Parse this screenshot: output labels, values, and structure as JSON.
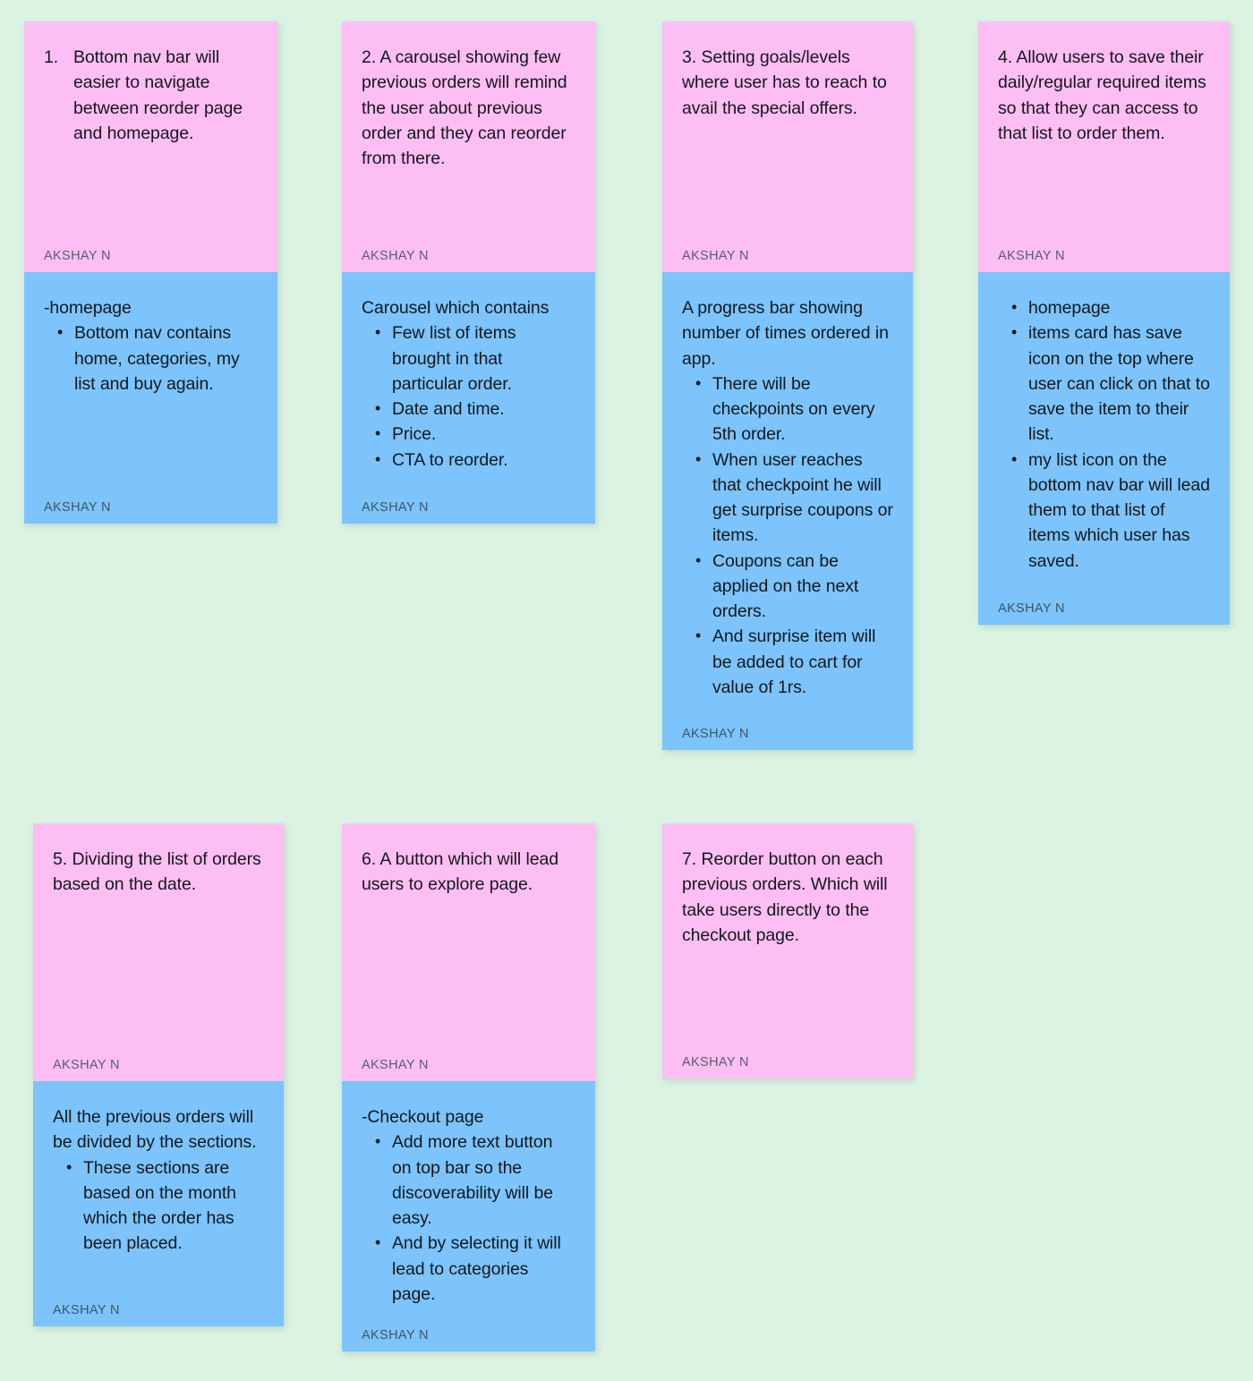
{
  "board": {
    "background_color": "#dbf3e3",
    "pink_color": "#fdbef4",
    "blue_color": "#7cc4fb",
    "author": "AKSHAY N"
  },
  "cards": [
    {
      "id": "1",
      "pink": {
        "number": "1.",
        "heading": "Bottom nav bar will easier to navigate between reorder page and homepage.",
        "author": "AKSHAY N"
      },
      "blue": {
        "lead": "-homepage",
        "bullets": [
          "Bottom nav contains home, categories, my list and buy again."
        ],
        "author": "AKSHAY N"
      }
    },
    {
      "id": "2",
      "pink": {
        "heading": "2. A carousel showing few previous orders will remind the user about previous order and they can reorder from there.",
        "author": "AKSHAY N"
      },
      "blue": {
        "lead": "Carousel which contains",
        "bullets": [
          "Few list of items brought in that particular order.",
          "Date and time.",
          "Price.",
          "CTA to reorder."
        ],
        "author": "AKSHAY N"
      }
    },
    {
      "id": "3",
      "pink": {
        "heading": "3. Setting goals/levels where user has to reach to avail the special offers.",
        "author": "AKSHAY N"
      },
      "blue": {
        "lead": "A progress bar showing number of times ordered in app.",
        "bullets": [
          "There will be checkpoints on every 5th order.",
          "When user reaches that checkpoint he will get surprise coupons or items.",
          "Coupons can be applied on the next orders.",
          "And surprise item will be added to cart for value of 1rs."
        ],
        "author": "AKSHAY N"
      }
    },
    {
      "id": "4",
      "pink": {
        "heading": "4. Allow users to save their daily/regular required items so that they can access to that list to order them.",
        "author": "AKSHAY N"
      },
      "blue": {
        "lead": "",
        "bullets": [
          "homepage",
          "items card has save icon on the  top where user can click on that to save the item to their list.",
          "my list icon on the bottom nav bar will lead them  to that list of items which user has saved."
        ],
        "author": "AKSHAY N"
      }
    },
    {
      "id": "5",
      "pink": {
        "heading": "5. Dividing the list of orders based on the date.",
        "author": "AKSHAY N"
      },
      "blue": {
        "lead": "All the previous orders will be divided by the sections.",
        "bullets": [
          "These sections are based on the month which the order has been placed."
        ],
        "author": "AKSHAY N"
      }
    },
    {
      "id": "6",
      "pink": {
        "heading": "6. A button which will lead users to explore page.",
        "author": "AKSHAY N"
      },
      "blue": {
        "lead": "-Checkout page",
        "bullets": [
          "Add more text button on top bar so the discoverability will be easy.",
          "And by selecting it will lead to categories page."
        ],
        "author": "AKSHAY N"
      }
    },
    {
      "id": "7",
      "pink": {
        "heading": "7. Reorder button on each previous orders. Which will take users directly to the checkout page.",
        "author": "AKSHAY N"
      }
    }
  ]
}
